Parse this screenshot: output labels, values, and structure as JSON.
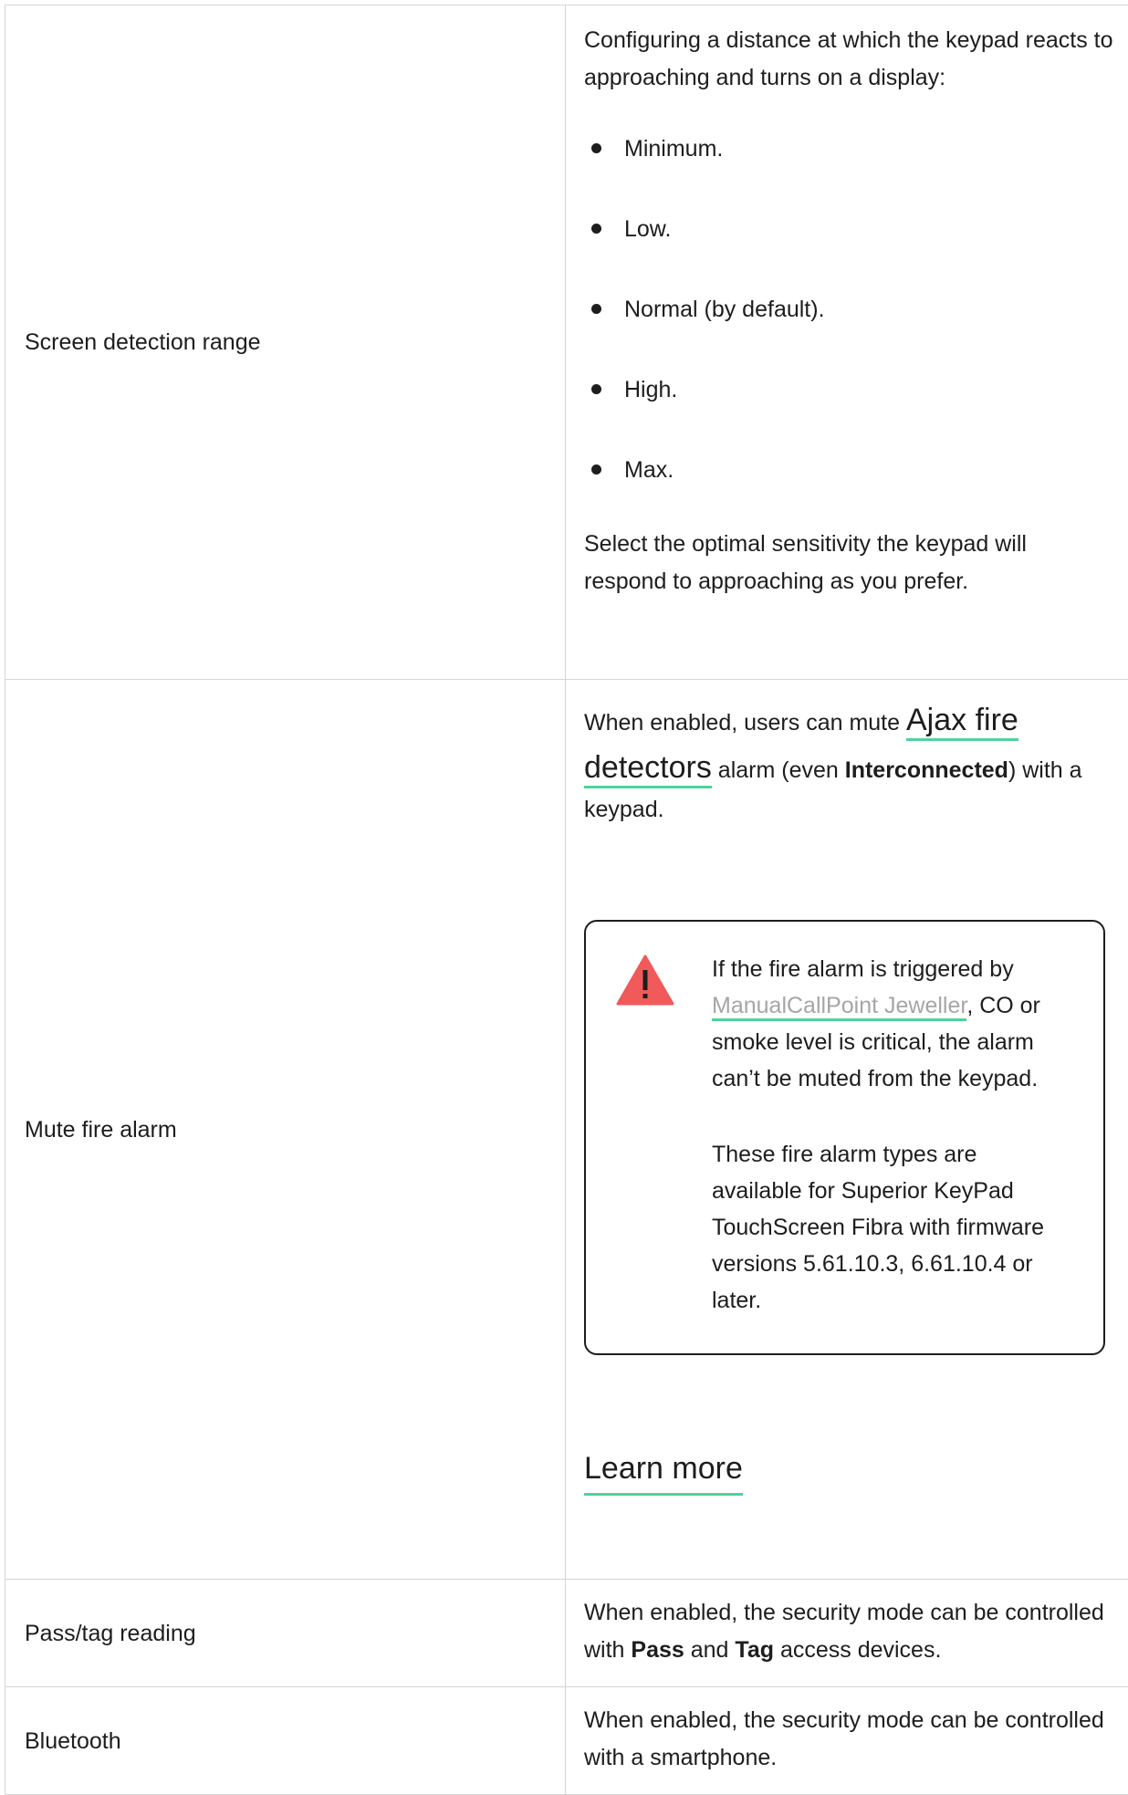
{
  "rows": [
    {
      "label": "Screen detection range",
      "intro": "Configuring a distance at which the keypad reacts to approaching and turns on a display:",
      "options": [
        "Minimum.",
        "Low.",
        "Normal (by default).",
        "High.",
        "Max."
      ],
      "outro": "Select the optimal sensitivity the keypad will respond to approaching as you prefer."
    },
    {
      "label": "Mute fire alarm",
      "text_prefix": "When enabled, users can mute ",
      "link_text": "Ajax fire detectors",
      "text_middle": " alarm (even ",
      "bold_text": "Interconnected",
      "text_suffix": ") with a keypad.",
      "warning": {
        "icon": "warning-triangle-icon",
        "line1_prefix": "If the fire alarm is triggered by ",
        "line1_link": "ManualCallPoint Jeweller",
        "line1_suffix": ", CO or smoke level is critical, the alarm can’t be muted from the keypad.",
        "line2": "These fire alarm types are available for Superior KeyPad TouchScreen Fibra with firmware versions 5.61.10.3, 6.61.10.4 or later."
      },
      "learn_more": "Learn more"
    },
    {
      "label": "Pass/tag reading",
      "text_prefix": "When enabled, the security mode can be controlled with ",
      "bold1": "Pass",
      "text_and": " and ",
      "bold2": "Tag",
      "text_suffix": " access devices."
    },
    {
      "label": "Bluetooth",
      "text": "When enabled, the security mode can be controlled with a smartphone."
    }
  ],
  "colors": {
    "accent_underline": "#4ed39a",
    "warning_red": "#f05a5a",
    "border": "#d6d6d6",
    "muted_link": "#a6a6a6"
  }
}
